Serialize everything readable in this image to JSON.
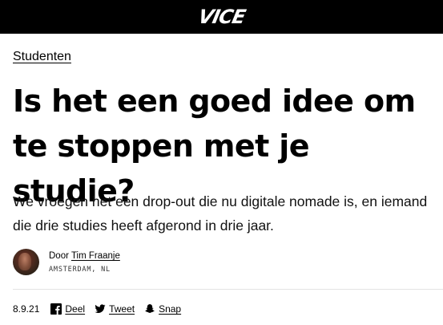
{
  "header": {
    "logo": "VICE"
  },
  "article": {
    "category": "Studenten",
    "headline": "Is het een goed idee om te stoppen met je studie?",
    "dek": "We vroegen het een drop-out die nu digitale nomade is, en iemand die drie studies heeft afgerond in drie jaar.",
    "byline": {
      "prefix": "Door",
      "author": "Tim Fraanje",
      "location": "AMSTERDAM, NL"
    },
    "date": "8.9.21"
  },
  "share": {
    "facebook_label": "Deel",
    "twitter_label": "Tweet",
    "snapchat_label": "Snap",
    "facebook_icon": "facebook-icon",
    "twitter_icon": "twitter-icon",
    "snapchat_icon": "snapchat-icon"
  },
  "colors": {
    "header_bg": "#000000",
    "page_bg": "#ffffff",
    "text": "#000000"
  }
}
